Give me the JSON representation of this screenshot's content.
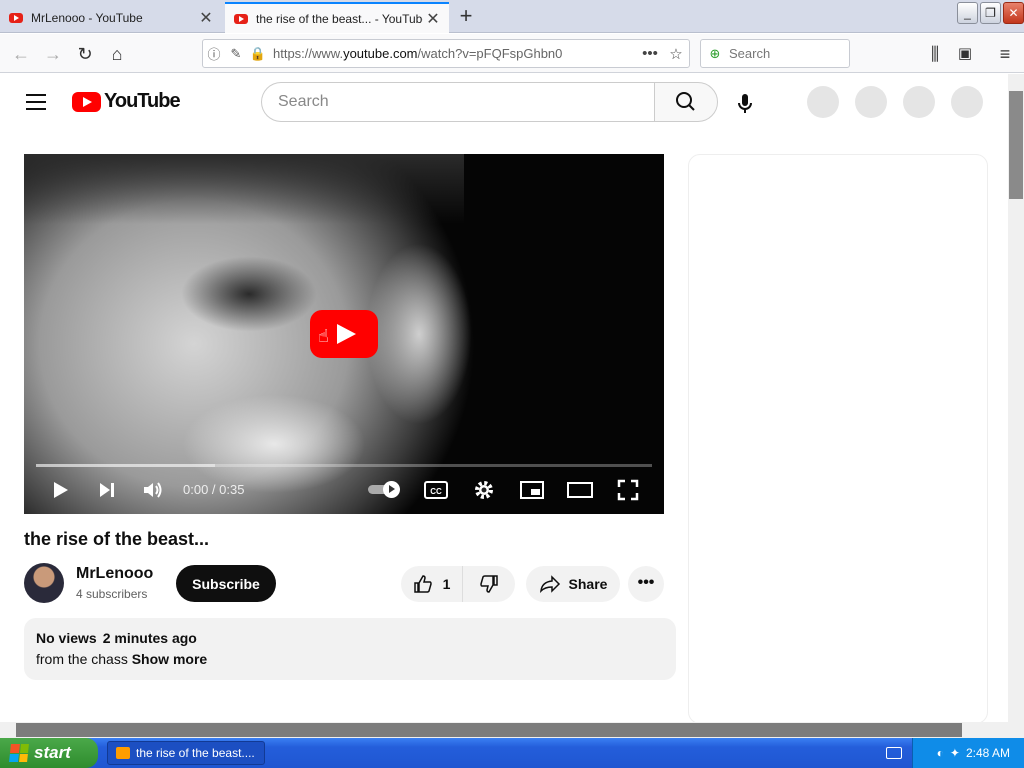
{
  "browser": {
    "tabs": [
      {
        "title": "MrLenooo - YouTube",
        "active": false
      },
      {
        "title": "the rise of the beast... - YouTube",
        "active": true
      }
    ],
    "url_prefix": "https://www.",
    "url_host": "youtube.com",
    "url_path": "/watch?v=pFQFspGhbn0",
    "search_placeholder": "Search"
  },
  "youtube": {
    "logo_text": "YouTube",
    "search_placeholder": "Search",
    "brand_red": "#ff0000"
  },
  "player": {
    "time": "0:00 / 0:35",
    "buffered_fraction": 0.29
  },
  "video": {
    "title": "the rise of the beast...",
    "channel": "MrLenooo",
    "subscribers": "4 subscribers",
    "subscribe_label": "Subscribe",
    "likes": "1",
    "share_label": "Share",
    "views": "No views",
    "uploaded": "2 minutes ago",
    "description": "from the chass",
    "show_more": "Show more"
  },
  "taskbar": {
    "start_label": "start",
    "task_title": "the rise of the beast....",
    "clock": "2:48 AM"
  }
}
